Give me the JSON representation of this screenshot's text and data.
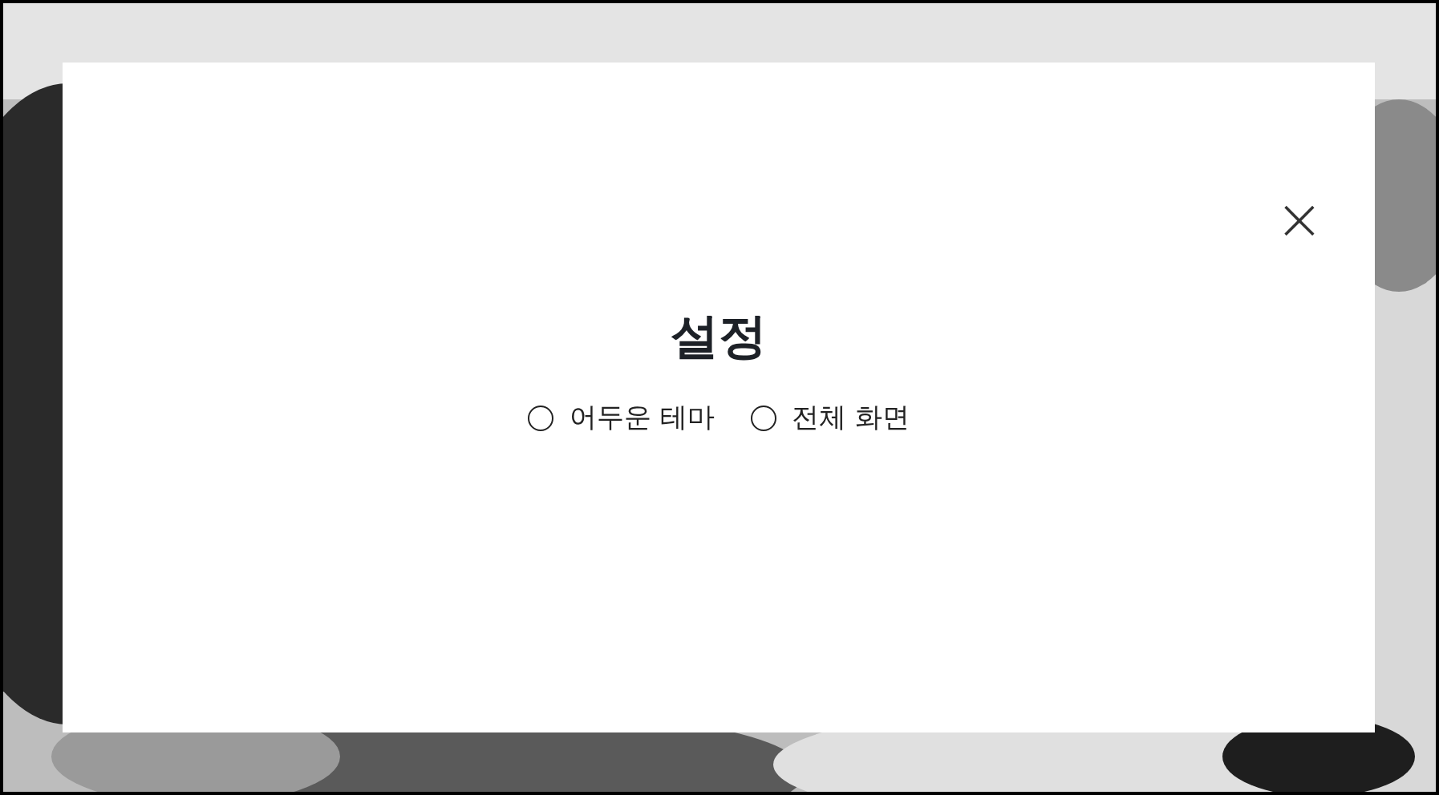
{
  "dialog": {
    "title": "설정",
    "close_icon": "×",
    "options": [
      {
        "label": "어두운 테마",
        "checked": false
      },
      {
        "label": "전체 화면",
        "checked": false
      }
    ]
  }
}
